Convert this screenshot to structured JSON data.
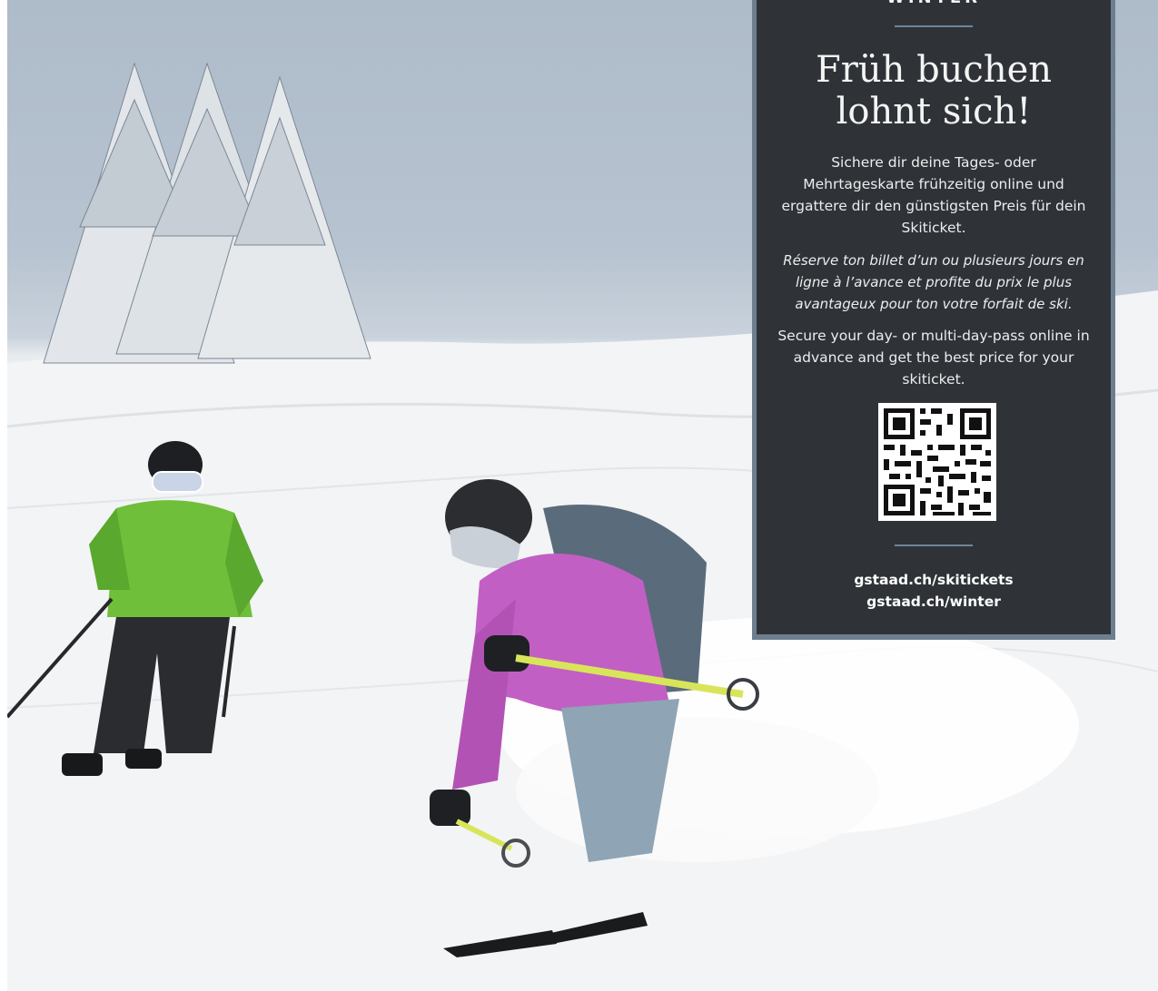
{
  "panel": {
    "eyebrow": "WINTER",
    "headline_line1": "Früh buchen",
    "headline_line2": "lohnt sich!",
    "text_de": "Sichere dir deine Tages- oder Mehrtageskarte frühzeitig online und ergattere dir den günstigsten Preis für dein Skiticket.",
    "text_fr": "Réserve ton billet d’un ou plusieurs jours en ligne à l’avance et profite du prix le plus avantageux pour ton votre forfait de ski.",
    "text_en": "Secure your day- or multi-day-pass online in advance and get the best price for your skiticket.",
    "link_1": "gstaad.ch/skitickets",
    "link_2": "gstaad.ch/winter"
  },
  "colors": {
    "panel_bg": "#2f3338",
    "panel_border": "#6d7f8f",
    "rule": "#6f8598",
    "jacket_green": "#6fbf3a",
    "jacket_purple": "#c25fc4"
  },
  "icons": {
    "qr": "qr-code-icon"
  }
}
